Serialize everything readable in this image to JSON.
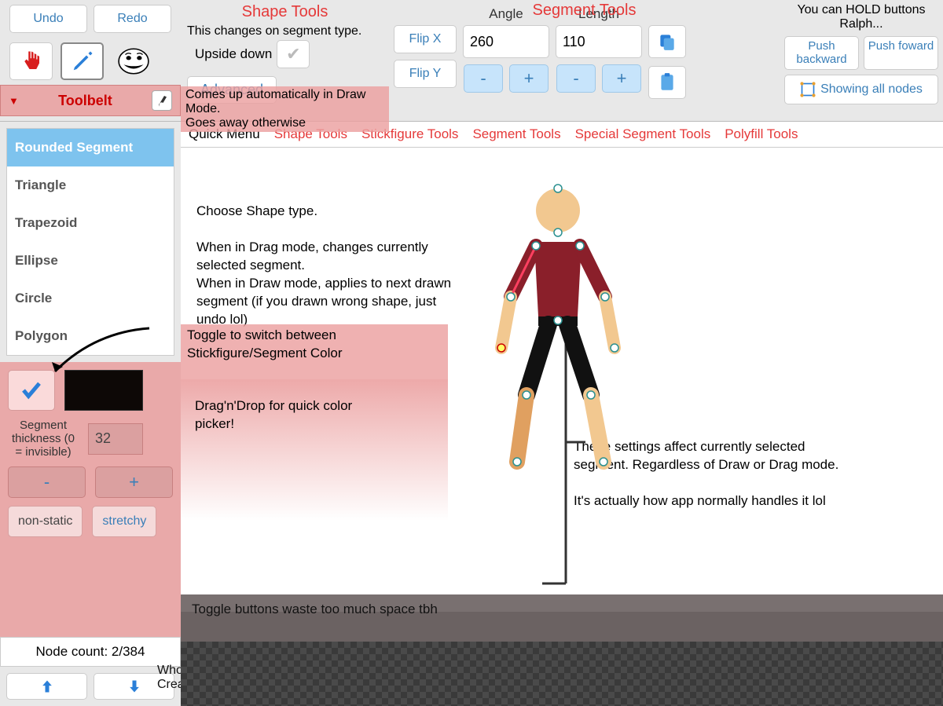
{
  "top": {
    "undo": "Undo",
    "redo": "Redo",
    "toolbelt": "Toolbelt"
  },
  "shapeTools": {
    "title": "Shape Tools",
    "subtitle": "This changes on segment type.",
    "upsideDown": "Upside down",
    "advanced": "Advanced"
  },
  "segmentTools": {
    "title": "Segment Tools",
    "flipX": "Flip X",
    "flipY": "Flip Y",
    "angleLabel": "Angle",
    "angleValue": "260",
    "lengthLabel": "Length",
    "lengthValue": "110",
    "minus": "-",
    "plus": "+"
  },
  "push": {
    "hint": "You can HOLD buttons Ralph...",
    "backward": "Push backward",
    "forward": "Push foward",
    "showingNodes": "Showing all nodes"
  },
  "quickMenu": {
    "items": [
      "Quick Menu",
      "Shape Tools",
      "Stickfigure Tools",
      "Segment Tools",
      "Special Segment Tools",
      "Polyfill Tools"
    ]
  },
  "shapes": {
    "items": [
      "Rounded Segment",
      "Triangle",
      "Trapezoid",
      "Ellipse",
      "Circle",
      "Polygon"
    ],
    "selectedIndex": 0
  },
  "panel": {
    "thicknessLabel": "Segment thickness (0 = invisible)",
    "thicknessValue": "32",
    "nonStatic": "non-static",
    "stretchy": "stretchy",
    "nodeCount": "Node count: 2/384"
  },
  "annotations": {
    "drawMode": "Comes up automatically in Draw Mode.\nGoes away otherwise",
    "chooseShape": "Choose Shape type.\n\nWhen in Drag mode, changes currently selected segment.\nWhen in Draw mode, applies to next drawn segment (if you drawn wrong shape, just undo lol)",
    "toggleColor": "Toggle to switch between Stickfigure/Segment Color",
    "dragDrop": "Drag'n'Drop for quick color picker!",
    "affectSeg": "These settings affect currently selected segment. Regardless of Draw or Drag mode.\n\nIt's actually how app normally handles it lol",
    "toggleWaste": "Toggle buttons waste too much space tbh",
    "memory": "Who tf runs out of Memory in Creation Menu"
  }
}
